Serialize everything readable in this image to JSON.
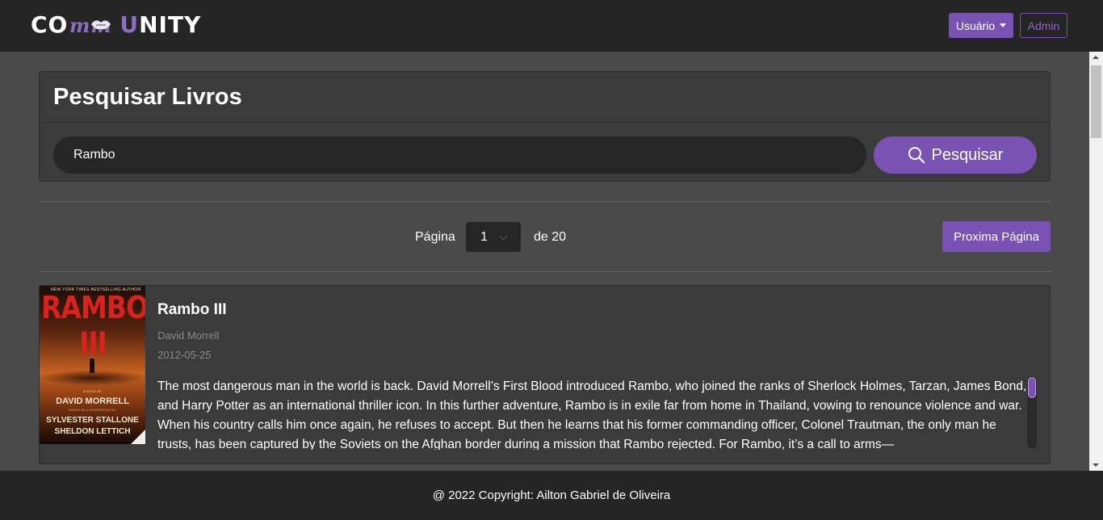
{
  "navbar": {
    "brand_left": "CO",
    "brand_mid_letters": "mm",
    "brand_u": "U",
    "brand_right": "NITY",
    "user_button": "Usuário",
    "admin_button": "Admin",
    "accent_color": "#7952b3"
  },
  "search": {
    "title": "Pesquisar Livros",
    "input_value": "Rambo",
    "button_label": "Pesquisar",
    "button_icon": "search-icon"
  },
  "pagination": {
    "label": "Página",
    "current_page": "1",
    "of_label": "de 20",
    "next_button": "Proxima Página"
  },
  "results": [
    {
      "title": "Rambo III",
      "author": "David Morrell",
      "date": "2012-05-25",
      "description": "The most dangerous man in the world is back. David Morrell’s First Blood introduced Rambo, who joined the ranks of Sherlock Holmes, Tarzan, James Bond, and Harry Potter as an international thriller icon. In this further adventure, Rambo is in exile far from home in Thailand, vowing to renounce violence and war. When his country calls him once again, he refuses to accept. But then he learns that his former commanding officer, Colonel Trautman, the only man he trusts, has been captured by the Soviets on the Afghan border during a mission that Rambo rejected. For Rambo, it’s a call to arms—",
      "cover": {
        "tagline": "NEW YORK TIMES BESTSELLING AUTHOR",
        "title": "RAMBO III",
        "novel_label": "A NOVEL BY",
        "author": "DAVID MORRELL",
        "based_on": "BASED ON A SCREENPLAY BY",
        "writer1": "SYLVESTER STALLONE",
        "writer2": "SHELDON LETTICH"
      }
    }
  ],
  "footer": {
    "text": "@ 2022 Copyright: Ailton Gabriel de Oliveira"
  }
}
